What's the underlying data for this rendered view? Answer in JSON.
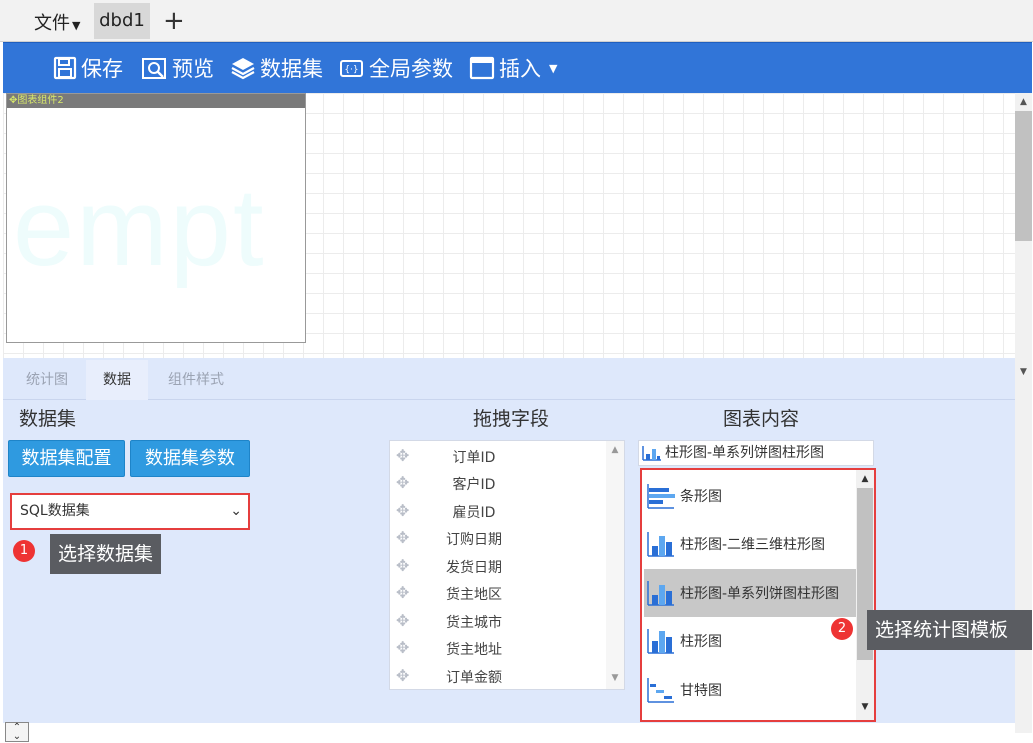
{
  "topbar": {
    "file_menu": "文件",
    "doc_tab": "dbd1",
    "add_tab": "+"
  },
  "toolbar": {
    "save": "保存",
    "preview": "预览",
    "dataset": "数据集",
    "global_params": "全局参数",
    "insert": "插入"
  },
  "canvas": {
    "widget_title": "图表组件2",
    "widget_watermark": "empt"
  },
  "panel": {
    "tabs": [
      "统计图",
      "数据",
      "组件样式"
    ],
    "active_tab": "数据",
    "dataset_title": "数据集",
    "fields_title": "拖拽字段",
    "chart_title": "图表内容",
    "btn_dataset_config": "数据集配置",
    "btn_dataset_params": "数据集参数",
    "dataset_select_value": "SQL数据集",
    "fields": [
      "订单ID",
      "客户ID",
      "雇员ID",
      "订购日期",
      "发货日期",
      "货主地区",
      "货主城市",
      "货主地址",
      "订单金额"
    ],
    "chart_current": "柱形图-单系列饼图柱形图",
    "chart_items": [
      "条形图",
      "柱形图-二维三维柱形图",
      "柱形图-单系列饼图柱形图",
      "柱形图",
      "甘特图"
    ],
    "selected_chart": "柱形图-单系列饼图柱形图"
  },
  "annotations": {
    "tip1_num": "1",
    "tip1_text": "选择数据集",
    "tip2_num": "2",
    "tip2_text": "选择统计图模板"
  },
  "colors": {
    "toolbar_bg": "#3175d8",
    "panel_bg": "#dee8fb",
    "button_blue": "#2f9ae0",
    "highlight_red": "#e53e3e"
  }
}
